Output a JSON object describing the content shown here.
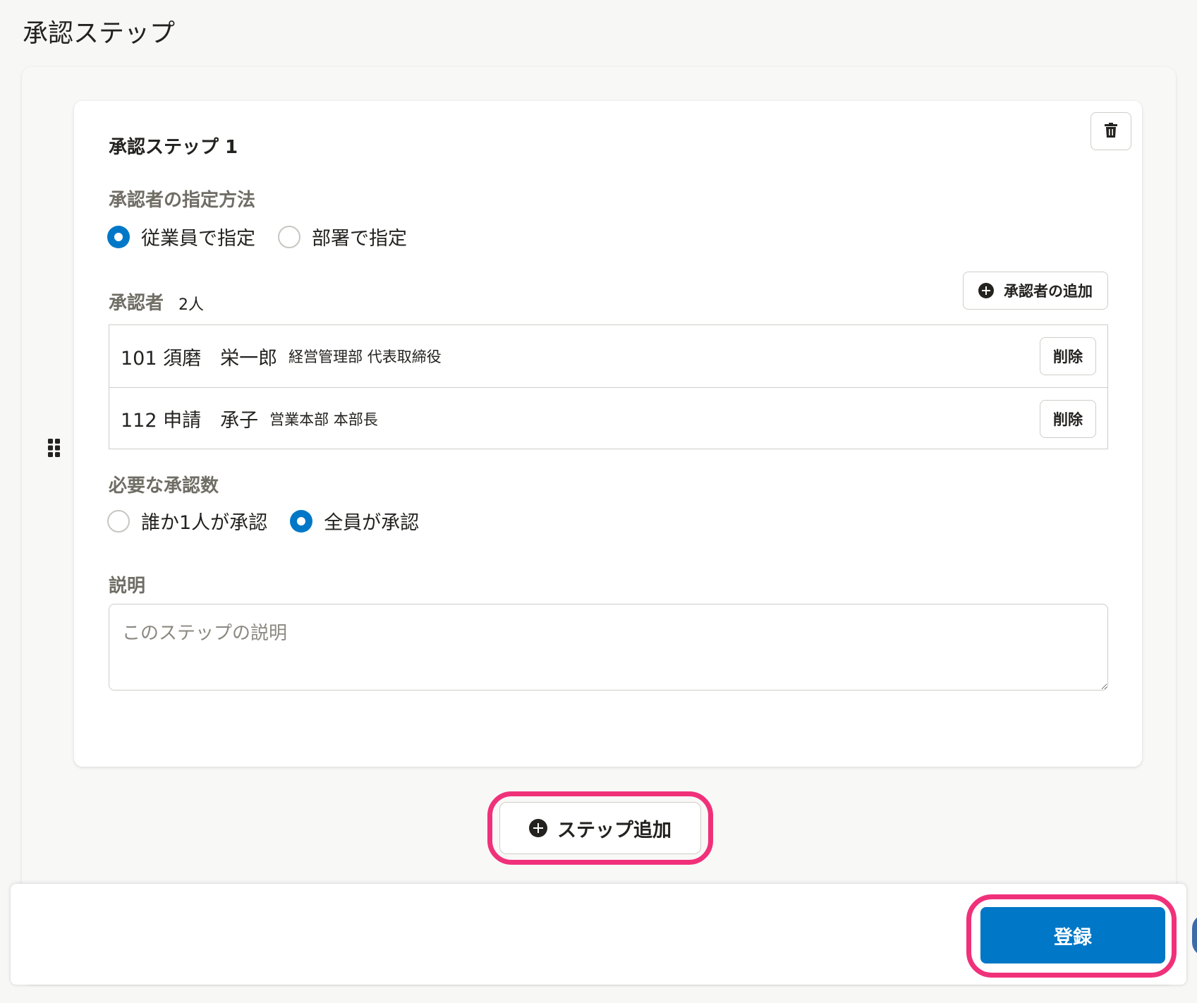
{
  "page": {
    "title": "承認ステップ"
  },
  "step": {
    "title": "承認ステップ 1",
    "method_label": "承認者の指定方法",
    "method_options": [
      {
        "label": "従業員で指定",
        "selected": true
      },
      {
        "label": "部署で指定",
        "selected": false
      }
    ],
    "approvers_label": "承認者",
    "approvers_count": "2人",
    "add_approver_label": "承認者の追加",
    "approvers": [
      {
        "name": "101 須磨　栄一郎",
        "dept": "経営管理部 代表取締役",
        "remove_label": "削除"
      },
      {
        "name": "112 申請　承子",
        "dept": "営業本部 本部長",
        "remove_label": "削除"
      }
    ],
    "required_label": "必要な承認数",
    "required_options": [
      {
        "label": "誰か1人が承認",
        "selected": false
      },
      {
        "label": "全員が承認",
        "selected": true
      }
    ],
    "description_label": "説明",
    "description_placeholder": "このステップの説明",
    "description_value": ""
  },
  "add_step_label": "ステップ追加",
  "submit_label": "登録",
  "colors": {
    "accent": "#0077c7",
    "highlight": "#f0317a"
  },
  "icons": {
    "delete_step": "trash-icon",
    "drag": "drag-handle-icon",
    "add": "plus-circle-icon"
  }
}
